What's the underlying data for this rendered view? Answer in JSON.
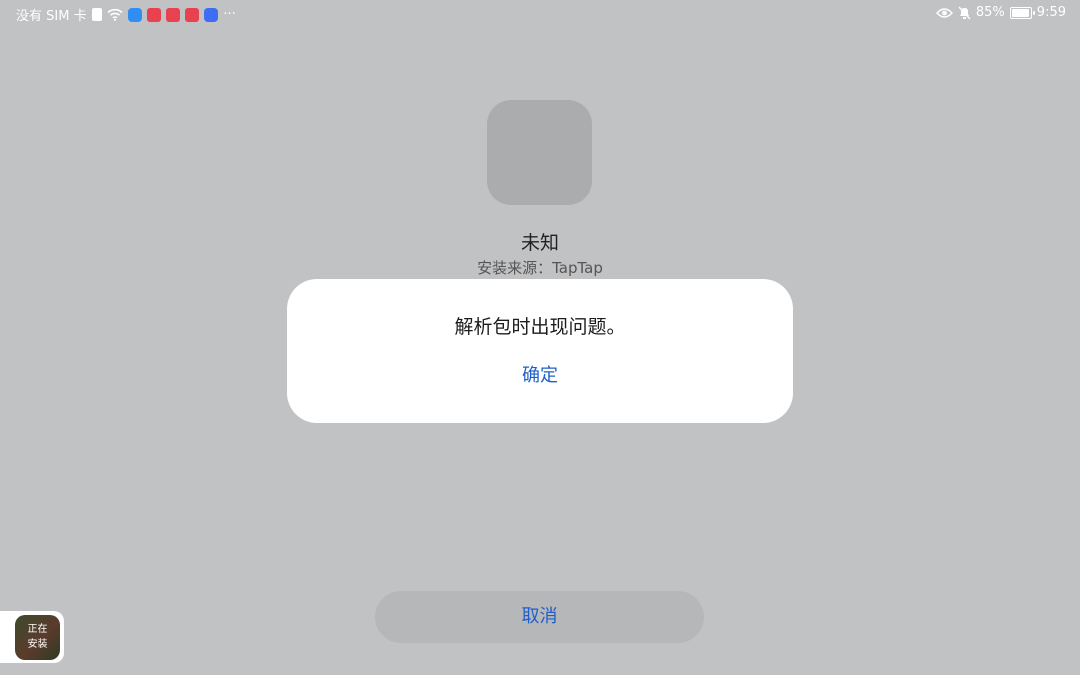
{
  "status_bar": {
    "carrier": "没有 SIM 卡",
    "more": "···",
    "battery_percent": "85%",
    "battery_level": 0.85,
    "time": "9:59",
    "colors": {
      "shield": "#2f8ef4",
      "notification": "#e8414f",
      "paw": "#3d6df2"
    }
  },
  "installer": {
    "app_name": "未知",
    "install_source": "安装来源：TapTap"
  },
  "dialog": {
    "message": "解析包时出现问题。",
    "confirm_label": "确定"
  },
  "footer": {
    "cancel_label": "取消"
  },
  "floating_badge": {
    "line1": "正在",
    "line2": "安装"
  },
  "colors": {
    "background": "#c1c2c4",
    "accent": "#1f5fc9",
    "dialog": "#ffffff"
  }
}
